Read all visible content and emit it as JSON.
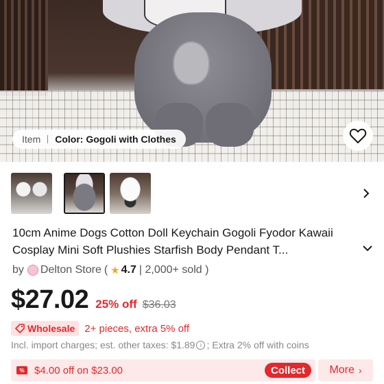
{
  "breadcrumb": {
    "item_label": "Item",
    "color_label": "Color: Gogoli with Clothes"
  },
  "icons": {
    "wishlist": "heart-icon",
    "thumbs_next": "chevron-right-icon",
    "title_expand": "chevron-down-icon",
    "store": "store-icon",
    "rating": "star-icon",
    "wholesale": "tag-icon",
    "info": "info-icon",
    "coupon": "coupon-icon"
  },
  "thumbnails": {
    "count": 3,
    "selected_index": 1
  },
  "product": {
    "title": "10cm Anime Dogs Cotton Doll Keychain Gogoli Fyodor Kawaii Cosplay Mini Soft Plushies Starfish Body Pendant T..."
  },
  "store": {
    "by": "by",
    "name": "Delton Store",
    "open_paren": "(",
    "rating": "4.7",
    "sold": "| 2,000+ sold )"
  },
  "price": {
    "current": "$27.02",
    "discount": "25% off",
    "original": "$36.03"
  },
  "wholesale": {
    "badge": "Wholesale",
    "text": "2+ pieces, extra 5% off"
  },
  "tax": {
    "prefix": "Incl. import charges; est. other taxes: $1.89",
    "suffix": "; Extra 2% off with coins"
  },
  "coupon": {
    "icon_text": "%",
    "text": "$4.00 off on $23.00",
    "collect_label": "Collect",
    "more_label": "More",
    "more_chevron": "›"
  },
  "colors": {
    "accent_red": "#e4282c",
    "coupon_bg": "#fde9e9",
    "wholesale_bg": "#fde2e2",
    "star": "#f5a623",
    "text_primary": "#191919",
    "text_secondary": "#555555",
    "text_muted": "#888888"
  }
}
